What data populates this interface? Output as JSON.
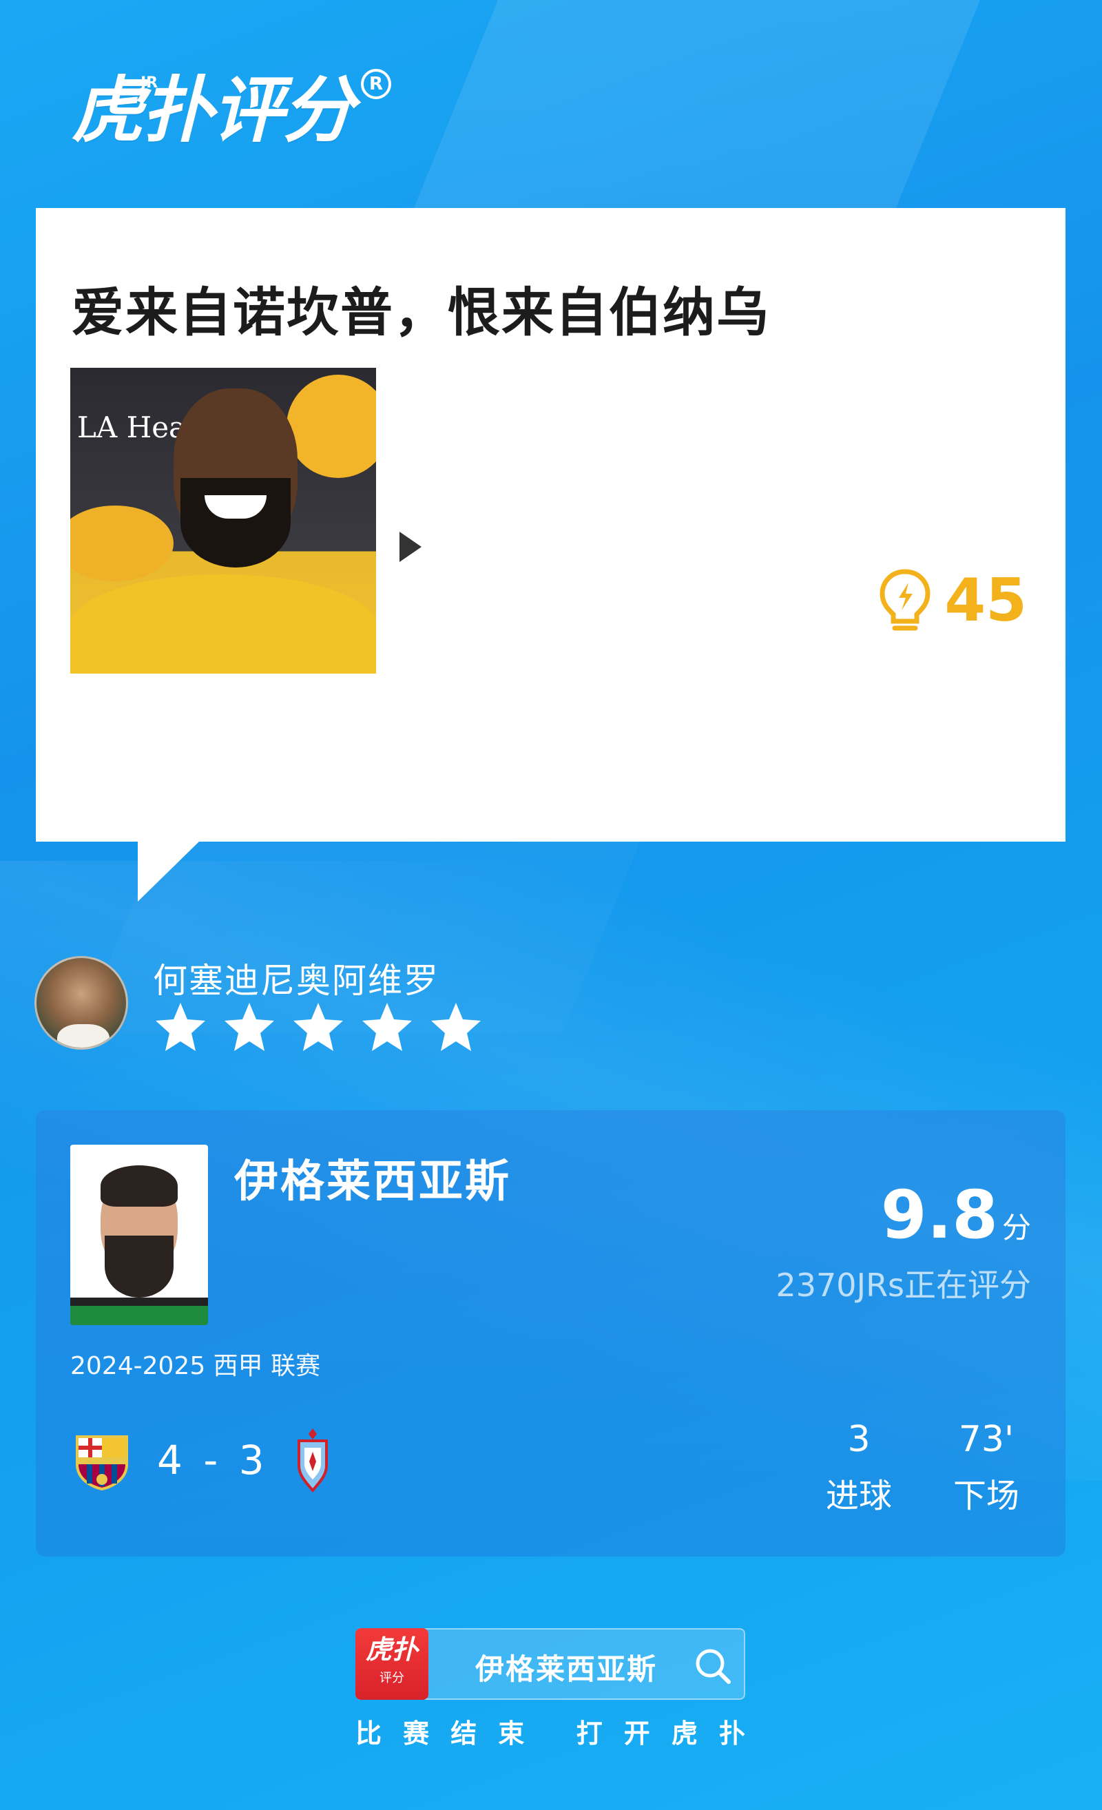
{
  "brand": {
    "logo": "虎扑评分",
    "logo_superscript": "JR",
    "registered": "R"
  },
  "comment": {
    "text": "爱来自诺坎普，恨来自伯纳乌",
    "image_overlay_text": "LA Healt",
    "likes": "45",
    "likes_icon": "lightbulb-icon"
  },
  "reviewer": {
    "name": "何塞迪尼奥阿维罗",
    "rating_stars": 5,
    "rating_max": 5
  },
  "player": {
    "name": "伊格莱西亚斯",
    "score": "9.8",
    "score_unit": "分",
    "raters": "2370JRs正在评分",
    "season": "2024-2025 西甲 联赛",
    "match_score": "4 - 3",
    "home_badge": "fcb-crest-icon",
    "away_badge": "celta-crest-icon",
    "stats": [
      {
        "value": "3",
        "label": "进球"
      },
      {
        "value": "73'",
        "label": "下场"
      }
    ]
  },
  "footer": {
    "app_logo_main": "虎扑",
    "app_logo_sub": "评分",
    "search_text": "伊格莱西亚斯",
    "tagline_left": [
      "比",
      "赛",
      "结",
      "束"
    ],
    "tagline_right": [
      "打",
      "开",
      "虎",
      "扑"
    ]
  },
  "colors": {
    "background": "#1593ec",
    "likes": "#f3b21b",
    "star": "#ffffff"
  }
}
